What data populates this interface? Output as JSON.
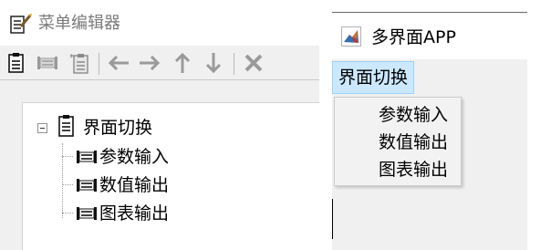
{
  "menu_editor": {
    "title": "菜单编辑器",
    "toolbar": {
      "buttons": [
        {
          "icon": "new-menu-icon",
          "name": "new-menu-button"
        },
        {
          "icon": "new-menu-item-icon",
          "name": "new-menu-item-button"
        },
        {
          "icon": "new-context-menu-icon",
          "name": "new-context-menu-button"
        },
        {
          "icon": "arrow-left-icon",
          "name": "move-left-button"
        },
        {
          "icon": "arrow-right-icon",
          "name": "move-right-button"
        },
        {
          "icon": "arrow-up-icon",
          "name": "move-up-button"
        },
        {
          "icon": "arrow-down-icon",
          "name": "move-down-button"
        },
        {
          "icon": "delete-x-icon",
          "name": "delete-button"
        }
      ]
    },
    "tree": {
      "root": {
        "label": "界面切换",
        "expanded": true
      },
      "items": [
        {
          "label": "参数输入"
        },
        {
          "label": "数值输出"
        },
        {
          "label": "图表输出"
        }
      ]
    }
  },
  "app_window": {
    "title": "多界面APP",
    "menubar": {
      "menu_label": "界面切换"
    },
    "dropdown": {
      "items": [
        {
          "label": "参数输入"
        },
        {
          "label": "数值输出"
        },
        {
          "label": "图表输出"
        }
      ]
    }
  },
  "colors": {
    "menu_highlight": "#cce8ff",
    "menu_highlight_border": "#99d1ff",
    "panel_background": "#f0f0f0",
    "disabled_title": "#7a7a7a"
  }
}
